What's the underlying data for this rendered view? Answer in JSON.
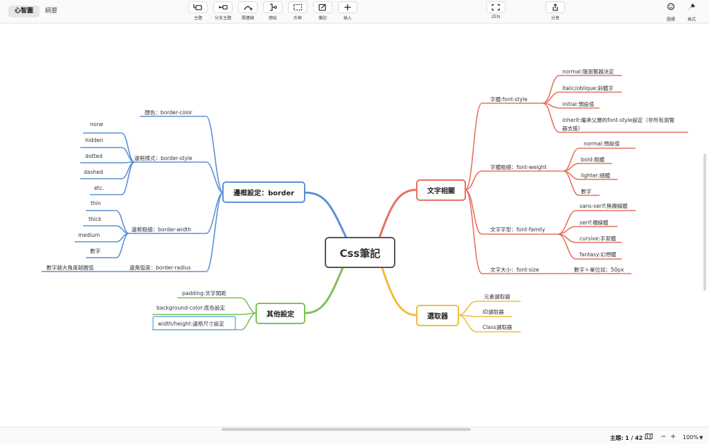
{
  "view_tabs": [
    "心智圖",
    "綱要"
  ],
  "toolbar": {
    "topic": "主題",
    "subtopic": "分支主題",
    "relationship": "關連線",
    "summary": "總結",
    "boundary": "外框",
    "note": "備記",
    "insert": "插入",
    "zen": "ZEN",
    "share": "分享",
    "icon": "圖標",
    "format": "格式"
  },
  "mindmap": {
    "central": "Css筆記",
    "border": {
      "title": "邊框設定：border",
      "color": "顏色：border-color",
      "style": "邊框樣式：border-style",
      "style_items": [
        "none",
        "hidden",
        "dotted",
        "dashed",
        "etc."
      ],
      "width": "邊框粗細：border-width",
      "width_items": [
        "thin",
        "thick",
        "medium",
        "數字"
      ],
      "radius": "邊角弧度：border-radius",
      "radius_item": "數字越大角度越圓弧"
    },
    "other": {
      "title": "其他設定",
      "items": [
        "padding:文字間距",
        "background-color:底色設定",
        "width/height:邊框尺寸設定"
      ]
    },
    "text": {
      "title": "文字相關",
      "font_style": "字體:font-style",
      "font_style_items": [
        "normal:隨瀏覽器決定",
        "italic/oblique:斜體字",
        "initial:預設值",
        "inherit:繼承父層的font-style設定（非所有瀏覽",
        "器支援）"
      ],
      "font_weight": "字體粗細：font-weight",
      "font_weight_items": [
        "normal:預設值",
        "bold:粗體",
        "lighter:細體",
        "數字"
      ],
      "font_family": "文字字型：font-family",
      "font_family_items": [
        "sans-serif:無襯線體",
        "serif:襯線體",
        "cursive:手寫體",
        "fantasy:幻想體"
      ],
      "font_size": "文字大小：font-size",
      "font_size_item": "數字＋單位如：50px"
    },
    "selector": {
      "title": "選取器",
      "items": [
        "元素選取器",
        "ID選取器",
        "Class選取器"
      ]
    }
  },
  "statusbar": {
    "topics": "主題: 1 / 42",
    "zoom": "100%",
    "zoom_out": "−",
    "zoom_in": "+"
  },
  "colors": {
    "border_branch": "#5b8fd9",
    "other_branch": "#7dc156",
    "text_branch": "#e8705f",
    "selector_branch": "#f2bb3a"
  }
}
